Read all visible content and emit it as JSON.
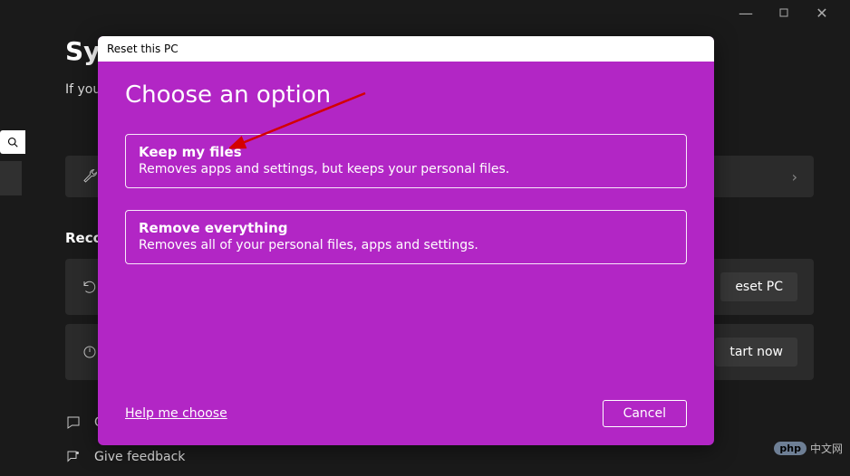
{
  "titlebar": {
    "minimize": "—",
    "maximize": "▢",
    "close": "✕"
  },
  "bg": {
    "page_title": "Sys",
    "page_sub": "If you'",
    "search_icon": "⌕",
    "recovery_heading": "Recov",
    "reset_btn": "eset PC",
    "start_btn": "tart now",
    "chevron": "›"
  },
  "footer": {
    "help": "G",
    "feedback": "Give feedback"
  },
  "modal": {
    "titlebar": "Reset this PC",
    "heading": "Choose an option",
    "options": [
      {
        "title": "Keep my files",
        "desc": "Removes apps and settings, but keeps your personal files."
      },
      {
        "title": "Remove everything",
        "desc": "Removes all of your personal files, apps and settings."
      }
    ],
    "help_link": "Help me choose",
    "cancel": "Cancel"
  },
  "watermark": {
    "php": "php",
    "cn": "中文网"
  }
}
